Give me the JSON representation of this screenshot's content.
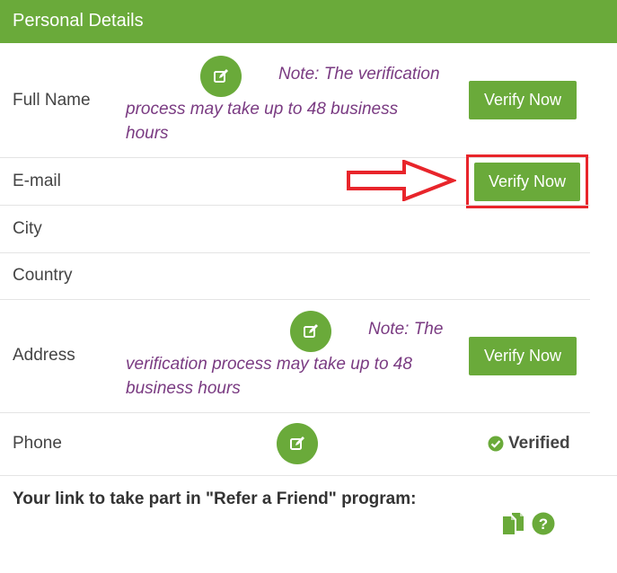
{
  "header": {
    "title": "Personal Details"
  },
  "rows": {
    "full_name": {
      "label": "Full Name",
      "note_line1": "Note: The verification",
      "note_line2": "process may take up to 48 business",
      "note_line3": "hours",
      "verify_label": "Verify Now"
    },
    "email": {
      "label": "E-mail",
      "verify_label": "Verify Now"
    },
    "city": {
      "label": "City"
    },
    "country": {
      "label": "Country"
    },
    "address": {
      "label": "Address",
      "note_line1": "Note: The",
      "note_line2": "verification process may take up to 48",
      "note_line3": "business hours",
      "verify_label": "Verify Now"
    },
    "phone": {
      "label": "Phone",
      "status": "Verified"
    }
  },
  "refer": {
    "text": "Your link to take part in \"Refer a Friend\" program:"
  },
  "colors": {
    "accent": "#6aaa3a",
    "note": "#7a3b82",
    "highlight": "#e8252b"
  },
  "icons": [
    "edit-icon",
    "arrow-right-icon",
    "check-circle-icon",
    "copy-icon",
    "help-icon"
  ]
}
